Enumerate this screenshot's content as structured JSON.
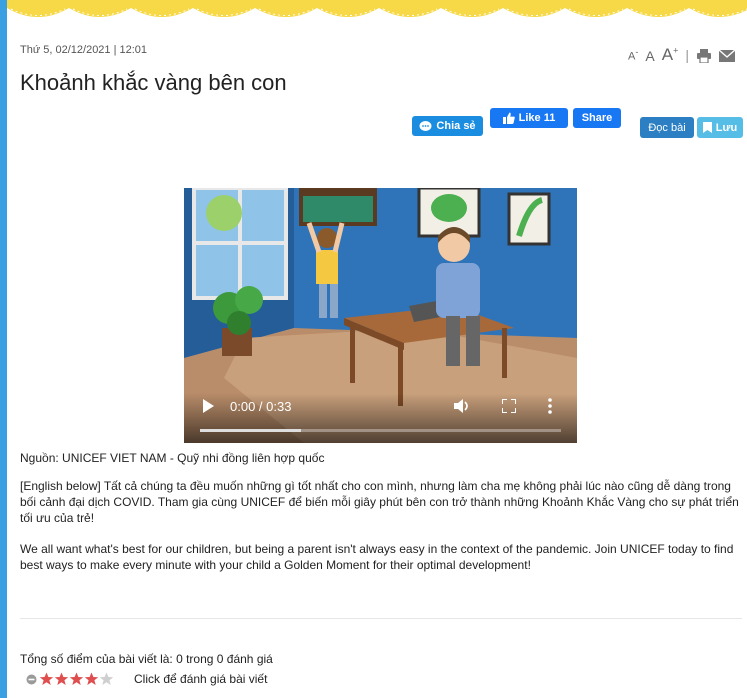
{
  "article": {
    "date": "Thứ 5, 02/12/2021 | 12:01",
    "title": "Khoảnh khắc vàng bên con",
    "source": "Nguồn: UNICEF VIET NAM - Quỹ nhi đồng liên hợp quốc",
    "paragraphs": [
      "[English below] Tất cả chúng ta đều muốn những gì tốt nhất cho con mình, nhưng làm cha mẹ không phải lúc nào cũng dễ dàng trong bối cảnh đại dịch COVID. Tham gia cùng UNICEF để biến mỗi giây phút bên con trở thành những Khoảnh Khắc Vàng cho sự phát triển tối ưu của trẻ!",
      "We all want what's best for our children, but being a parent isn't always easy in the context of the pandemic. Join UNICEF today to find best ways to make every minute with your child a Golden Moment for their optimal development!"
    ]
  },
  "font_tools": {
    "small": "A",
    "small_sup": "-",
    "normal": "A",
    "large": "A",
    "large_sup": "+",
    "separator": "|",
    "print_icon": "print-icon",
    "mail_icon": "mail-icon"
  },
  "share": {
    "chia_se": "Chia sẻ",
    "like": "Like 11",
    "share": "Share",
    "doc_bai": "Đọc bài",
    "luu": "Lưu"
  },
  "video": {
    "time": "0:00 / 0:33",
    "progress": 0.28
  },
  "rating": {
    "summary": "Tổng số điểm của bài viết là: 0 trong 0 đánh giá",
    "cta": "Click để đánh giá bài viết",
    "stars_shown": 4,
    "stars_total": 5
  },
  "colors": {
    "frame": "#3aa0e2",
    "facebook": "#1877f2",
    "star": "#e04f4f"
  }
}
